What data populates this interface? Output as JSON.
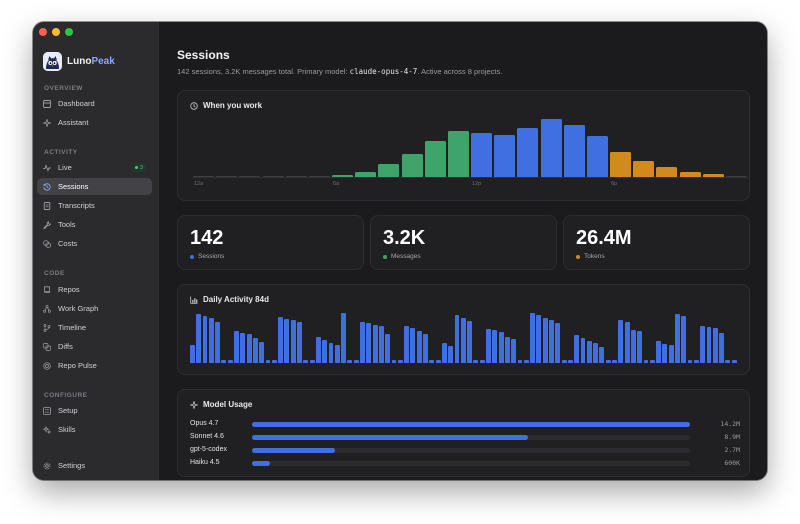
{
  "brand": {
    "name_part1": "Luno",
    "name_part2": "Peak"
  },
  "sidebar": {
    "sections": {
      "overview": "OVERVIEW",
      "activity": "ACTIVITY",
      "code": "CODE",
      "configure": "CONFIGURE"
    },
    "items": {
      "dashboard": "Dashboard",
      "assistant": "Assistant",
      "live": "Live",
      "live_badge": "3",
      "sessions": "Sessions",
      "transcripts": "Transcripts",
      "tools": "Tools",
      "costs": "Costs",
      "repos": "Repos",
      "work_graph": "Work Graph",
      "timeline": "Timeline",
      "diffs": "Diffs",
      "repo_pulse": "Repo Pulse",
      "setup": "Setup",
      "skills": "Skills",
      "settings": "Settings"
    },
    "active": "sessions"
  },
  "page": {
    "title": "Sessions",
    "subtitle_pre": "142 sessions, 3.2K messages total. Primary model: ",
    "subtitle_model": "claude-opus-4-7",
    "subtitle_post": ". Active across 8 projects."
  },
  "when_you_work": {
    "title": "When you work",
    "ticks": [
      "12a",
      "6a",
      "12p",
      "6p"
    ],
    "colors": {
      "low": "#3d3d42",
      "morning": "#3fa46a",
      "day": "#3f6fe0",
      "evening": "#d28a1c"
    },
    "hours": [
      {
        "h": 0,
        "v": 1,
        "c": "low"
      },
      {
        "h": 1,
        "v": 1,
        "c": "low"
      },
      {
        "h": 2,
        "v": 1,
        "c": "low"
      },
      {
        "h": 3,
        "v": 1,
        "c": "low"
      },
      {
        "h": 4,
        "v": 1,
        "c": "low"
      },
      {
        "h": 5,
        "v": 1,
        "c": "low"
      },
      {
        "h": 6,
        "v": 4,
        "c": "morning"
      },
      {
        "h": 7,
        "v": 8,
        "c": "morning"
      },
      {
        "h": 8,
        "v": 22,
        "c": "morning"
      },
      {
        "h": 9,
        "v": 39,
        "c": "morning"
      },
      {
        "h": 10,
        "v": 60,
        "c": "morning"
      },
      {
        "h": 11,
        "v": 77,
        "c": "morning"
      },
      {
        "h": 12,
        "v": 74,
        "c": "day"
      },
      {
        "h": 13,
        "v": 70,
        "c": "day"
      },
      {
        "h": 14,
        "v": 82,
        "c": "day"
      },
      {
        "h": 15,
        "v": 97,
        "c": "day"
      },
      {
        "h": 16,
        "v": 87,
        "c": "day"
      },
      {
        "h": 17,
        "v": 69,
        "c": "day"
      },
      {
        "h": 18,
        "v": 42,
        "c": "evening"
      },
      {
        "h": 19,
        "v": 27,
        "c": "evening"
      },
      {
        "h": 20,
        "v": 17,
        "c": "evening"
      },
      {
        "h": 21,
        "v": 9,
        "c": "evening"
      },
      {
        "h": 22,
        "v": 5,
        "c": "evening"
      },
      {
        "h": 23,
        "v": 1,
        "c": "low"
      }
    ]
  },
  "stats": [
    {
      "value": "142",
      "label": "Sessions",
      "color": "#3f6fe0"
    },
    {
      "value": "3.2K",
      "label": "Messages",
      "color": "#3fa46a"
    },
    {
      "value": "26.4M",
      "label": "Tokens",
      "color": "#d28a1c"
    }
  ],
  "daily_activity": {
    "title": "Daily Activity 84d",
    "values": [
      34,
      95,
      91,
      87,
      80,
      5,
      5,
      63,
      59,
      57,
      48,
      40,
      5,
      5,
      89,
      85,
      83,
      79,
      5,
      5,
      51,
      44,
      38,
      35,
      97,
      5,
      5,
      80,
      77,
      73,
      71,
      57,
      5,
      5,
      71,
      67,
      62,
      56,
      5,
      5,
      39,
      33,
      93,
      88,
      82,
      5,
      5,
      66,
      64,
      60,
      51,
      47,
      5,
      5,
      97,
      94,
      88,
      84,
      77,
      5,
      5,
      55,
      48,
      43,
      38,
      32,
      5,
      5,
      84,
      79,
      65,
      63,
      5,
      5,
      42,
      36,
      34,
      95,
      91,
      5,
      5,
      72,
      70,
      67,
      59,
      5,
      5
    ]
  },
  "model_usage": {
    "title": "Model Usage",
    "models": [
      {
        "name": "Opus 4.7",
        "share": 1.0,
        "value": "14.2M"
      },
      {
        "name": "Sonnet 4.6",
        "share": 0.63,
        "value": "8.9M"
      },
      {
        "name": "gpt-5-codex",
        "share": 0.19,
        "value": "2.7M"
      },
      {
        "name": "Haiku 4.5",
        "share": 0.04,
        "value": "600K"
      }
    ]
  }
}
